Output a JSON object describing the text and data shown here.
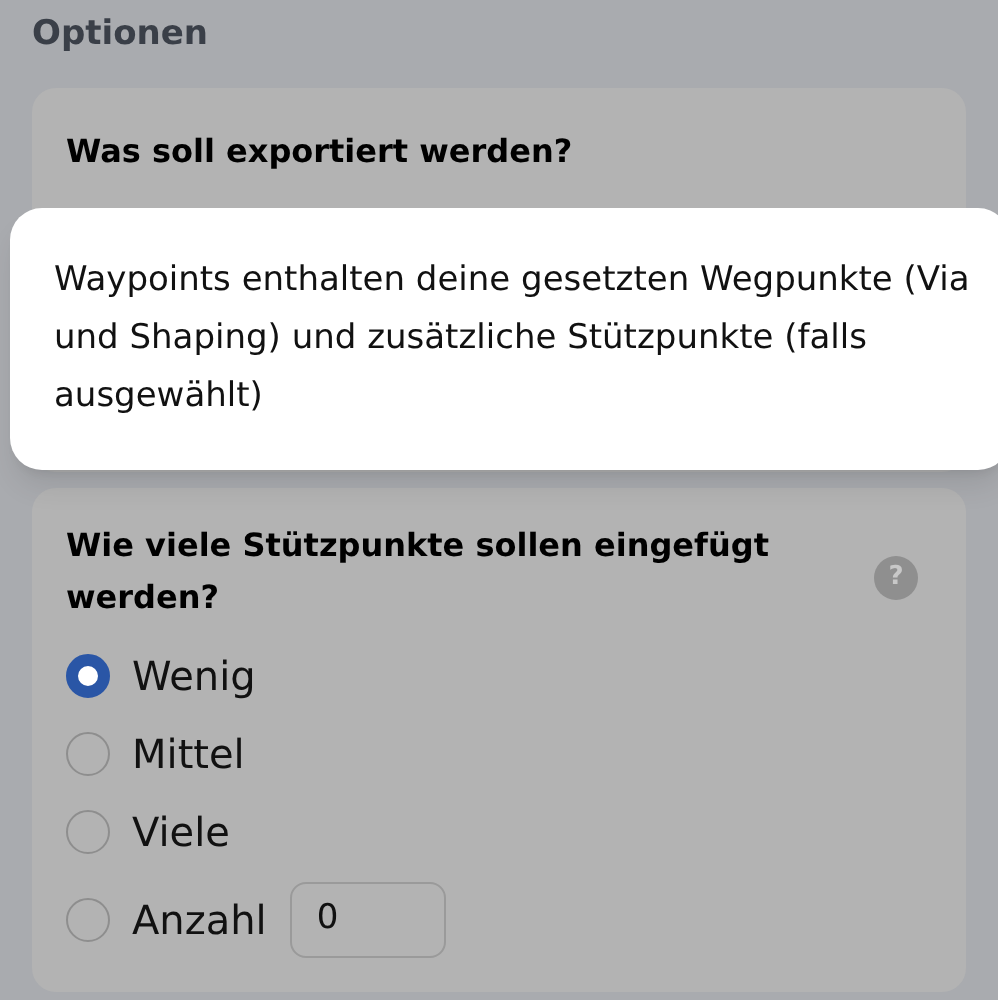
{
  "section_title": "Optionen",
  "export_card": {
    "title": "Was soll exportiert werden?"
  },
  "tooltip": {
    "text": "Waypoints enthalten deine gesetzten Wegpunkte (Via und Shaping) und zusätzliche Stützpunkte (falls ausgewählt)"
  },
  "points_card": {
    "title": "Wie viele Stützpunkte sollen eingefügt werden?",
    "help": "?",
    "options": [
      {
        "label": "Wenig",
        "selected": true,
        "kind": "plain"
      },
      {
        "label": "Mittel",
        "selected": false,
        "kind": "plain"
      },
      {
        "label": "Viele",
        "selected": false,
        "kind": "plain"
      },
      {
        "label": "Anzahl",
        "selected": false,
        "kind": "count",
        "value": "0"
      }
    ]
  }
}
